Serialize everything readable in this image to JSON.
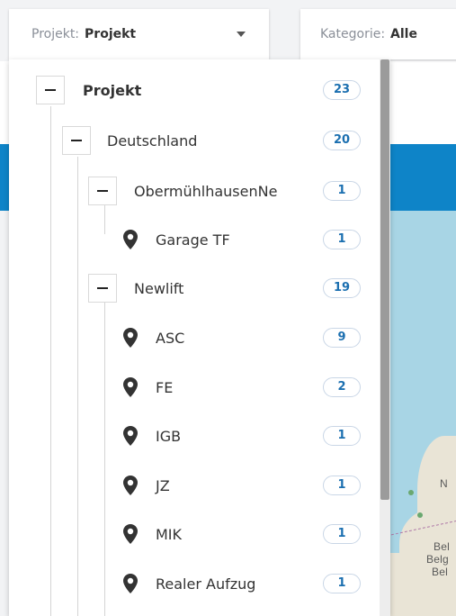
{
  "filters": {
    "projekt": {
      "label": "Projekt:",
      "value": "Projekt"
    },
    "kategorie": {
      "label": "Kategorie:",
      "value": "Alle"
    }
  },
  "tree": {
    "root": {
      "label": "Projekt",
      "count": "23"
    },
    "deutschland": {
      "label": "Deutschland",
      "count": "20"
    },
    "obermuehl": {
      "label": "ObermühlhausenNe",
      "count": "1"
    },
    "garage": {
      "label": "Garage TF",
      "count": "1"
    },
    "newlift": {
      "label": "Newlift",
      "count": "19"
    },
    "asc": {
      "label": "ASC",
      "count": "9"
    },
    "fe": {
      "label": "FE",
      "count": "2"
    },
    "igb": {
      "label": "IGB",
      "count": "1"
    },
    "jz": {
      "label": "JZ",
      "count": "1"
    },
    "mik": {
      "label": "MIK",
      "count": "1"
    },
    "realer": {
      "label": "Realer Aufzug",
      "count": "1"
    }
  },
  "map_labels": {
    "n": "N",
    "bel1": "Bel",
    "bel2": "Belg",
    "bel3": "Bel"
  },
  "colors": {
    "accent_blue": "#0e84c8",
    "badge_text": "#1b6fb0",
    "map_water": "#a8d5e5"
  },
  "icons": {
    "pin": "map-pin-icon",
    "toggle": "minus-icon",
    "caret": "caret-down-icon"
  }
}
